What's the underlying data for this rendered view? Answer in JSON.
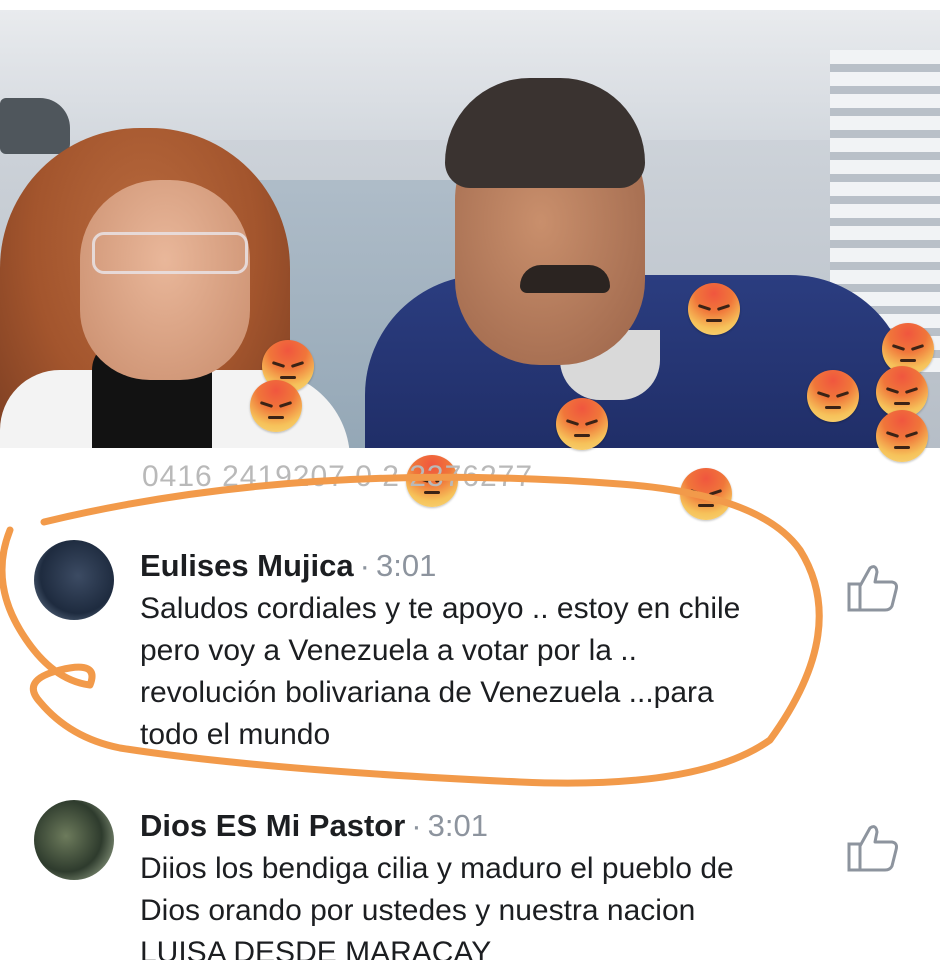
{
  "video": {
    "phone_line": "0416 2419207 0  2 2376277"
  },
  "comments": [
    {
      "author": "Eulises Mujica",
      "separator": "·",
      "time": "3:01",
      "text": "Saludos cordiales y te apoyo .. estoy en chile pero voy a Venezuela a votar por la .. revolución bolivariana de Venezuela ...para todo el mundo"
    },
    {
      "author": "Dios ES Mi Pastor",
      "separator": "·",
      "time": "3:01",
      "text": "Diios los bendiga cilia y maduro el pueblo de Dios orando por ustedes y nuestra nacion LUISA DESDE MARACAY"
    }
  ],
  "icons": {
    "reaction": "angry-reaction-icon",
    "like": "thumbs-up-icon"
  },
  "colors": {
    "highlight_stroke": "#f29a4a",
    "angry_top": "#f0563e",
    "angry_bottom": "#f6c25a",
    "meta_gray": "#8d949e"
  }
}
